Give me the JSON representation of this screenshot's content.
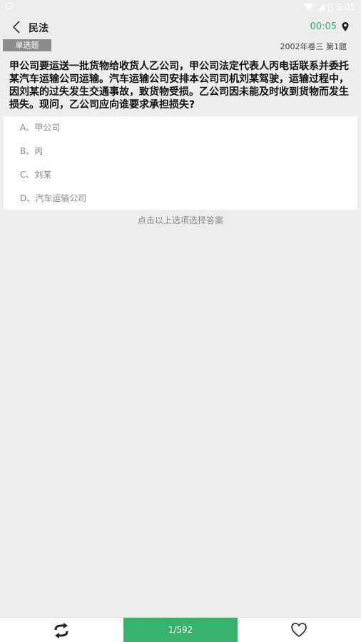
{
  "status_bar": {
    "time": "5:05"
  },
  "header": {
    "title": "民法",
    "timer": "00:05"
  },
  "meta": {
    "question_type": "单选题",
    "source": "2002年卷三 第1题"
  },
  "question": {
    "text": "甲公司要运送一批货物给收货人乙公司，甲公司法定代表人丙电话联系并委托某汽车运输公司运输。汽车运输公司安排本公司司机刘某驾驶，运输过程中，因刘某的过失发生交通事故，致货物受损。乙公司因未能及时收到货物而发生损失。现问，乙公司应向谁要求承担损失?"
  },
  "options": [
    {
      "label": "A、甲公司"
    },
    {
      "label": "B、丙"
    },
    {
      "label": "C、刘某"
    },
    {
      "label": "D、汽车运输公司"
    }
  ],
  "hint": "点击以上选项选择答案",
  "footer": {
    "progress": "1/592"
  },
  "colors": {
    "accent": "#37b26a",
    "timer": "#2fae64",
    "badge": "#8c8c8c"
  },
  "icons": [
    "back-icon",
    "location-pin-icon",
    "swap-icon",
    "heart-icon"
  ]
}
